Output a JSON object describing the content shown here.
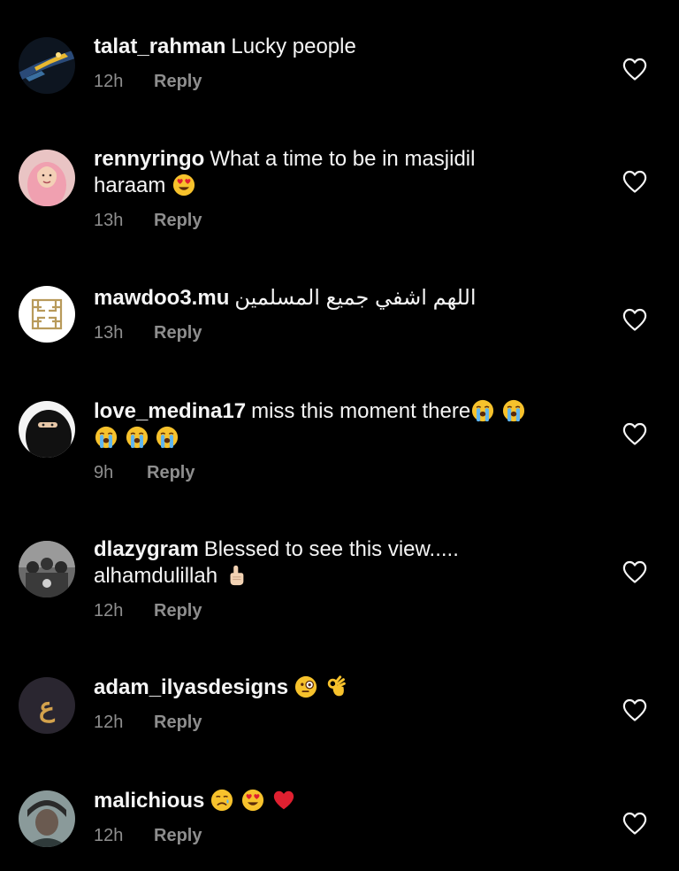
{
  "comments": [
    {
      "username": "talat_rahman",
      "text": "Lucky people",
      "time": "12h",
      "reply_label": "Reply"
    },
    {
      "username": "rennyringo",
      "text": "What a time to be in masjidil",
      "text_line2": "haraam",
      "emojis": [
        "heart-eyes-emoji"
      ],
      "time": "13h",
      "reply_label": "Reply"
    },
    {
      "username": "mawdoo3.mu",
      "text": "اللهم اشفي جميع المسلمين",
      "time": "13h",
      "reply_label": "Reply"
    },
    {
      "username": "love_medina17",
      "text": "miss this moment there",
      "emojis": [
        "loudly-crying-emoji",
        "loudly-crying-emoji",
        "loudly-crying-emoji",
        "loudly-crying-emoji",
        "loudly-crying-emoji"
      ],
      "time": "9h",
      "reply_label": "Reply"
    },
    {
      "username": "dlazygram",
      "text": "Blessed to see this view.....",
      "text_line2": "alhamdulillah",
      "emojis": [
        "index-pointing-up-emoji"
      ],
      "time": "12h",
      "reply_label": "Reply"
    },
    {
      "username": "adam_ilyasdesigns",
      "text": "",
      "emojis": [
        "monocle-face-emoji",
        "ok-hand-emoji"
      ],
      "time": "12h",
      "reply_label": "Reply"
    },
    {
      "username": "malichious",
      "text": "",
      "emojis": [
        "crying-face-emoji",
        "heart-eyes-emoji",
        "red-heart-emoji"
      ],
      "time": "12h",
      "reply_label": "Reply"
    }
  ],
  "icons": {
    "like": "heart-outline-icon"
  },
  "colors": {
    "background": "#000000",
    "primary_text": "#f5f5f5",
    "secondary_text": "#8e8e8e",
    "emoji_yellow": "#f7c22c",
    "heart_red": "#e02030"
  }
}
